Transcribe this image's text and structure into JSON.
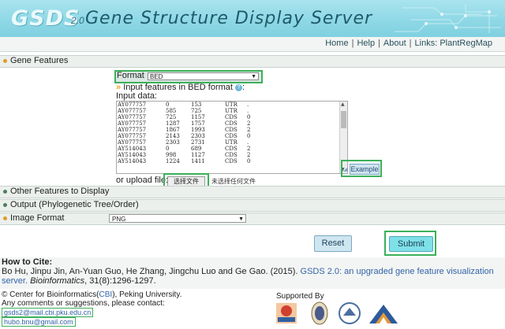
{
  "header": {
    "logo": "GSDS",
    "logo_version": "2.0",
    "title": "Gene Structure Display Server"
  },
  "nav": {
    "home": "Home",
    "help": "Help",
    "about": "About",
    "links_label": "Links:",
    "plantregmap": "PlantRegMap"
  },
  "sections": {
    "gene_features": "Gene Features",
    "other_features": "Other Features to Display",
    "output": "Output (Phylogenetic Tree/Order)",
    "image_format": "Image Format"
  },
  "form": {
    "format_label": "Format",
    "format_value": "BED",
    "input_header": "Input features in BED format",
    "input_header_suffix": ":",
    "input_data_label": "Input data:",
    "rows": [
      [
        "AY077757",
        "0",
        "153",
        "UTR",
        "."
      ],
      [
        "AY077757",
        "585",
        "725",
        "UTR",
        "."
      ],
      [
        "AY077757",
        "725",
        "1157",
        "CDS",
        "0"
      ],
      [
        "AY077757",
        "1287",
        "1757",
        "CDS",
        "2"
      ],
      [
        "AY077757",
        "1867",
        "1993",
        "CDS",
        "2"
      ],
      [
        "AY077757",
        "2143",
        "2303",
        "CDS",
        "0"
      ],
      [
        "AY077757",
        "2303",
        "2731",
        "UTR",
        "."
      ],
      [
        "AY514043",
        "0",
        "689",
        "CDS",
        "2"
      ],
      [
        "AY514043",
        "998",
        "1127",
        "CDS",
        "2"
      ],
      [
        "AY514043",
        "1224",
        "1411",
        "CDS",
        "0"
      ]
    ],
    "example_button": "Example",
    "upload_label": "or upload file:",
    "file_button": "选择文件",
    "file_status": "未选择任何文件",
    "image_format_value": "PNG",
    "reset_button": "Reset",
    "submit_button": "Submit"
  },
  "citation": {
    "heading": "How to Cite:",
    "authors": "Bo Hu, Jinpu Jin, An-Yuan Guo, He Zhang, Jingchu Luo and Ge Gao. (2015).",
    "paper_title": "GSDS 2.0: an upgraded gene feature visualization",
    "line2_link": "server.",
    "journal": "Bioinformatics",
    "volume": ", 31(8):1296-1297."
  },
  "footer": {
    "copyright_prefix": "© Center for Bioinformatics(",
    "cbi": "CBI",
    "copyright_suffix": "), Peking University.",
    "contact": "Any comments or suggestions, please contact:",
    "email1": "gsds2@mail.cbi.pku.edu.cn",
    "email2": "hubo.bnu@gmail.com",
    "supported_by": "Supported By"
  },
  "colors": {
    "header_bg": "#8fd8e6",
    "highlight_green": "#3cb05a",
    "link_blue": "#3364a8",
    "submit_bg": "#7fe0e8"
  }
}
